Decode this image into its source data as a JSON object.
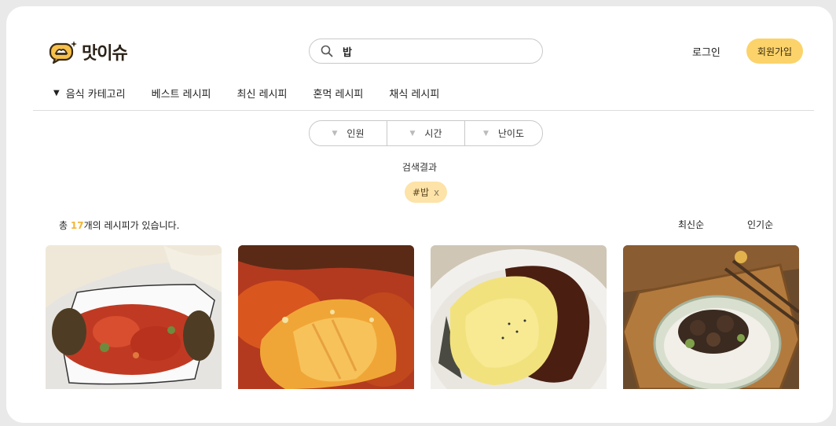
{
  "logo": {
    "text": "맛이슈"
  },
  "search": {
    "value": "밥",
    "icon": "search-icon"
  },
  "auth": {
    "login_label": "로그인",
    "signup_label": "회원가입"
  },
  "nav": {
    "category_label": "음식 카테고리",
    "items": [
      "베스트 레시피",
      "최신 레시피",
      "혼먹 레시피",
      "채식 레시피"
    ]
  },
  "filters": [
    "인원",
    "시간",
    "난이도"
  ],
  "results": {
    "label": "검색결과",
    "tag": "#밥",
    "tag_remove": "x",
    "count_prefix": "총 ",
    "count": "17",
    "count_suffix": "개의 레시피가 있습니다."
  },
  "sort": {
    "latest": "최신순",
    "popular": "인기순"
  },
  "recipes": [
    {
      "image": "spicy-pork-stirfry-image"
    },
    {
      "image": "braised-fish-image"
    },
    {
      "image": "omurice-image"
    },
    {
      "image": "eggplant-rice-bowl-image"
    }
  ],
  "colors": {
    "accent": "#fbd36a",
    "count_highlight": "#f2b637",
    "tag_bg": "#fde3a8"
  }
}
